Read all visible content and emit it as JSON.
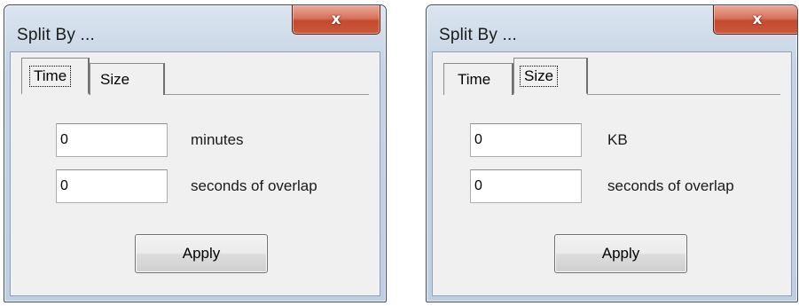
{
  "dialogs": [
    {
      "title": "Split By ...",
      "close_glyph": "x",
      "tabs": [
        {
          "label": "Time",
          "selected": true
        },
        {
          "label": "Size",
          "selected": false
        }
      ],
      "fields": [
        {
          "value": "0",
          "label": "minutes"
        },
        {
          "value": "0",
          "label": "seconds of overlap"
        }
      ],
      "apply_label": "Apply"
    },
    {
      "title": "Split By ...",
      "close_glyph": "x",
      "tabs": [
        {
          "label": "Time",
          "selected": false
        },
        {
          "label": "Size",
          "selected": true
        }
      ],
      "fields": [
        {
          "value": "0",
          "label": "KB"
        },
        {
          "value": "0",
          "label": "seconds of overlap"
        }
      ],
      "apply_label": "Apply"
    }
  ],
  "colors": {
    "close_button": "#c9593b",
    "dialog_face": "#f0f0f0",
    "frame": "#bfcee1"
  },
  "icons": {
    "close": "close-icon"
  }
}
